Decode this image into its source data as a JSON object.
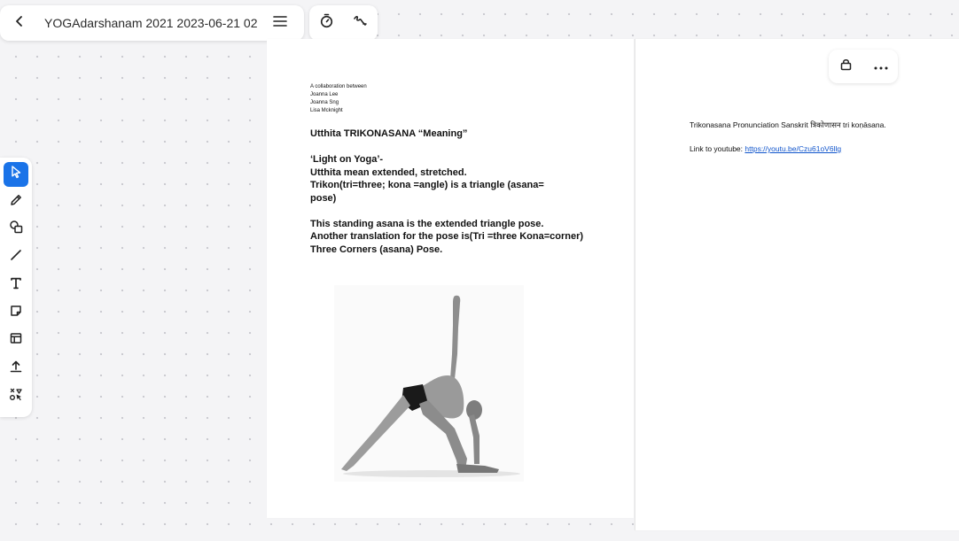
{
  "header": {
    "title": "YOGAdarshanam 2021 2023-06-21 02:...",
    "back_icon": "chevron-left-icon",
    "menu_icon": "hamburger-menu-icon",
    "timer_icon": "timer-icon",
    "scribble_icon": "scribble-icon"
  },
  "toolbar": {
    "tools": [
      {
        "name": "select",
        "icon": "cursor-icon",
        "active": true
      },
      {
        "name": "pen",
        "icon": "pen-icon"
      },
      {
        "name": "shapes",
        "icon": "shapes-icon"
      },
      {
        "name": "line",
        "icon": "line-icon"
      },
      {
        "name": "text",
        "icon": "text-icon"
      },
      {
        "name": "sticky-note",
        "icon": "sticky-note-icon"
      },
      {
        "name": "template",
        "icon": "template-icon"
      },
      {
        "name": "upload",
        "icon": "upload-icon"
      },
      {
        "name": "ai-tools",
        "icon": "magic-shapes-icon"
      }
    ],
    "active_color": "#1a73e8"
  },
  "page1": {
    "collab": {
      "intro": "A collaboration between",
      "names": [
        "Joanna Lee",
        "Joanna Sng",
        "Lisa Mcknight"
      ]
    },
    "heading": "Utthita TRIKONASANA “Meaning”",
    "body": {
      "l1": "‘Light on Yoga’-",
      "l2": "Utthita mean extended, stretched.",
      "l3": "Trikon(tri=three; kona =angle) is a triangle (asana=",
      "l4": "pose)",
      "l5": "This standing asana is the extended triangle pose.",
      "l6": "Another translation for the pose is(Tri =three Kona=corner)",
      "l7": "Three Corners (asana) Pose."
    }
  },
  "page2": {
    "pronunciation": "Trikonasana Pronunciation Sanskrit त्रिकोणासन   tri koṇāsana.",
    "link_prefix": "Link to youtube: ",
    "link_text": "https://youtu.be/Czu61oV6llg",
    "lock_icon": "lock-icon",
    "more_icon": "more-horizontal-icon"
  }
}
